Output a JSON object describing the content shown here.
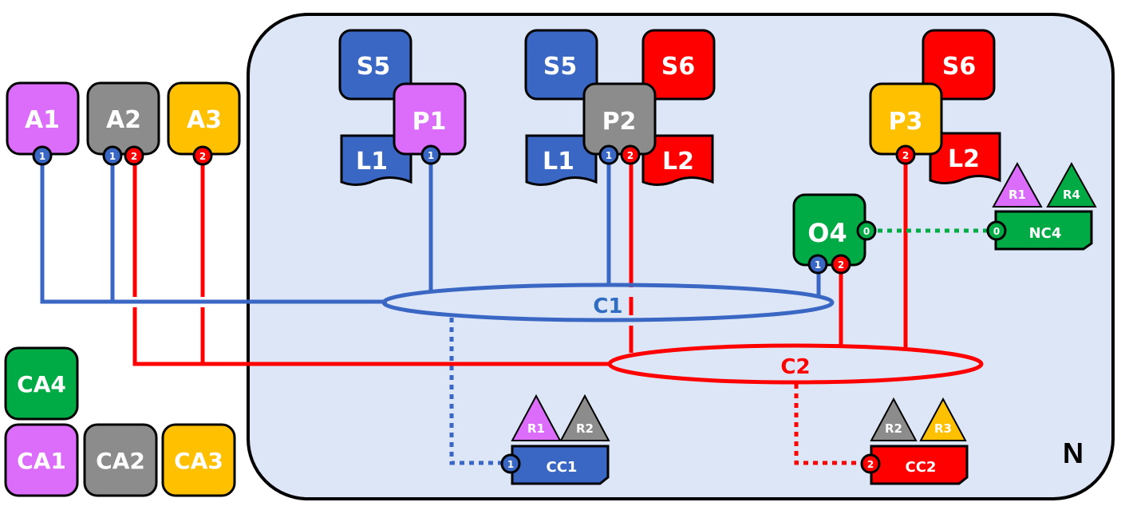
{
  "colors": {
    "blue": "#3A66C4",
    "red": "#FF0000",
    "gray": "#8C8C8C",
    "purple": "#DC6CFA",
    "amber": "#FFC000",
    "green": "#00AA44",
    "network_fill": "#DCE6F6",
    "outline": "#000000",
    "c1_label": "#2F6DC0"
  },
  "network": {
    "label": "N"
  },
  "actors": [
    {
      "id": "A1",
      "label": "A1",
      "color": "purple",
      "ports": [
        "1"
      ]
    },
    {
      "id": "A2",
      "label": "A2",
      "color": "gray",
      "ports": [
        "1",
        "2"
      ]
    },
    {
      "id": "A3",
      "label": "A3",
      "color": "amber",
      "ports": [
        "2"
      ]
    }
  ],
  "certificate_authorities": [
    {
      "id": "CA4",
      "label": "CA4",
      "color": "green"
    },
    {
      "id": "CA1",
      "label": "CA1",
      "color": "purple"
    },
    {
      "id": "CA2",
      "label": "CA2",
      "color": "gray"
    },
    {
      "id": "CA3",
      "label": "CA3",
      "color": "amber"
    }
  ],
  "peers": [
    {
      "id": "P1",
      "label": "P1",
      "color": "purple",
      "ports": [
        "1"
      ],
      "smart_contracts": [
        "S5"
      ],
      "ledgers": [
        "L1"
      ]
    },
    {
      "id": "P2",
      "label": "P2",
      "color": "gray",
      "ports": [
        "1",
        "2"
      ],
      "smart_contracts": [
        "S5",
        "S6"
      ],
      "ledgers": [
        "L1",
        "L2"
      ]
    },
    {
      "id": "P3",
      "label": "P3",
      "color": "amber",
      "ports": [
        "2"
      ],
      "smart_contracts": [
        "S6"
      ],
      "ledgers": [
        "L2"
      ]
    }
  ],
  "orderer": {
    "id": "O4",
    "label": "O4",
    "color": "green",
    "ports": [
      "1",
      "2",
      "0"
    ]
  },
  "channels": [
    {
      "id": "C1",
      "label": "C1",
      "color": "blue"
    },
    {
      "id": "C2",
      "label": "C2",
      "color": "red"
    }
  ],
  "channel_configs": [
    {
      "id": "CC1",
      "label": "CC1",
      "color": "blue",
      "port": "1",
      "policies": [
        {
          "label": "R1",
          "color": "purple"
        },
        {
          "label": "R2",
          "color": "gray"
        }
      ]
    },
    {
      "id": "CC2",
      "label": "CC2",
      "color": "red",
      "port": "2",
      "policies": [
        {
          "label": "R2",
          "color": "gray"
        },
        {
          "label": "R3",
          "color": "amber"
        }
      ]
    }
  ],
  "network_config": {
    "id": "NC4",
    "label": "NC4",
    "color": "green",
    "port": "0",
    "policies": [
      {
        "label": "R1",
        "color": "purple"
      },
      {
        "label": "R4",
        "color": "green"
      }
    ]
  }
}
